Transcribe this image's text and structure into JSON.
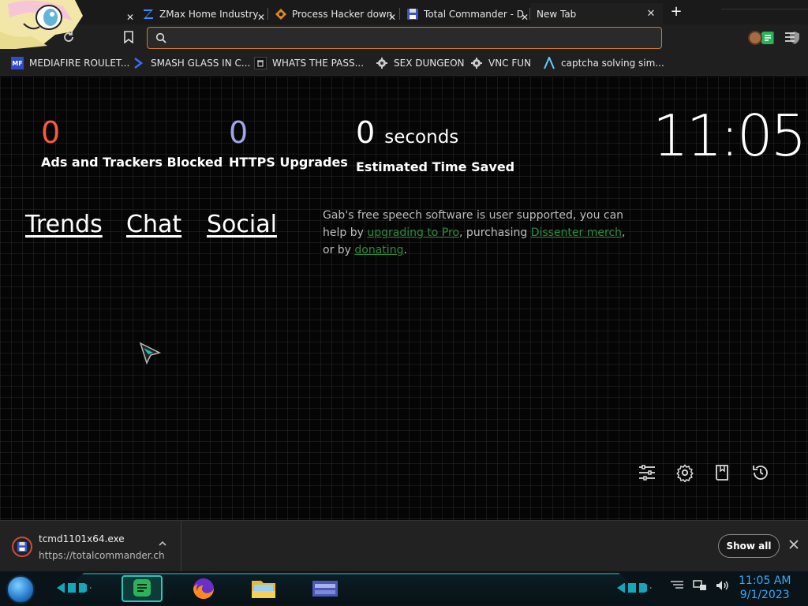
{
  "tabs": [
    {
      "label": "ZMax Home Industry",
      "favicon": "z-logo-icon",
      "active": false
    },
    {
      "label": "Process Hacker down",
      "favicon": "process-hacker-icon",
      "active": false
    },
    {
      "label": "Total Commander - D",
      "favicon": "floppy-icon",
      "active": false
    },
    {
      "label": "New Tab",
      "favicon": "",
      "active": true
    }
  ],
  "tab_close_glyph": "✕",
  "new_tab_glyph": "+",
  "omnibox": {
    "value": "",
    "placeholder": ""
  },
  "bookmarks": [
    {
      "label": "MEDIAFIRE ROULET...",
      "favicon": "mf-icon"
    },
    {
      "label": "SMASH GLASS IN C...",
      "favicon": "chevron-logo-icon"
    },
    {
      "label": "WHATS THE PASS...",
      "favicon": "bin-icon"
    },
    {
      "label": "SEX DUNGEON",
      "favicon": "gear-robot-icon"
    },
    {
      "label": "VNC FUN",
      "favicon": "gear-robot-icon"
    },
    {
      "label": "captcha solving sim...",
      "favicon": "a-logo-icon"
    }
  ],
  "stats": {
    "ads_blocked": {
      "value": "0",
      "caption": "Ads and Trackers Blocked",
      "color": "#fa5a3c"
    },
    "https_upgrades": {
      "value": "0",
      "caption": "HTTPS Upgrades",
      "color": "#a0a5eb"
    },
    "time_saved": {
      "value": "0",
      "unit": "seconds",
      "caption": "Estimated Time Saved",
      "color": "#ffffff"
    }
  },
  "clock": "11:05",
  "links": {
    "trends": "Trends",
    "chat": "Chat",
    "social": "Social"
  },
  "sponsor": {
    "part1": "Gab's free speech software is user supported, you can help by",
    "link1": "upgrading to Pro",
    "part2": ", purchasing",
    "link2": "Dissenter merch",
    "part3": ", or by",
    "link3": "donating",
    "part4": "."
  },
  "download": {
    "filename": "tcmd1101x64.exe",
    "source": "https://totalcommander.ch",
    "show_all": "Show all"
  },
  "taskbar": {
    "time": "11:05 AM",
    "date": "9/1/2023"
  },
  "colors": {
    "accent_orange": "#d07a2a",
    "link_green": "#2e8a3e",
    "taskbar_cyan": "#16c0d8",
    "clock_blue": "#33aaff"
  }
}
